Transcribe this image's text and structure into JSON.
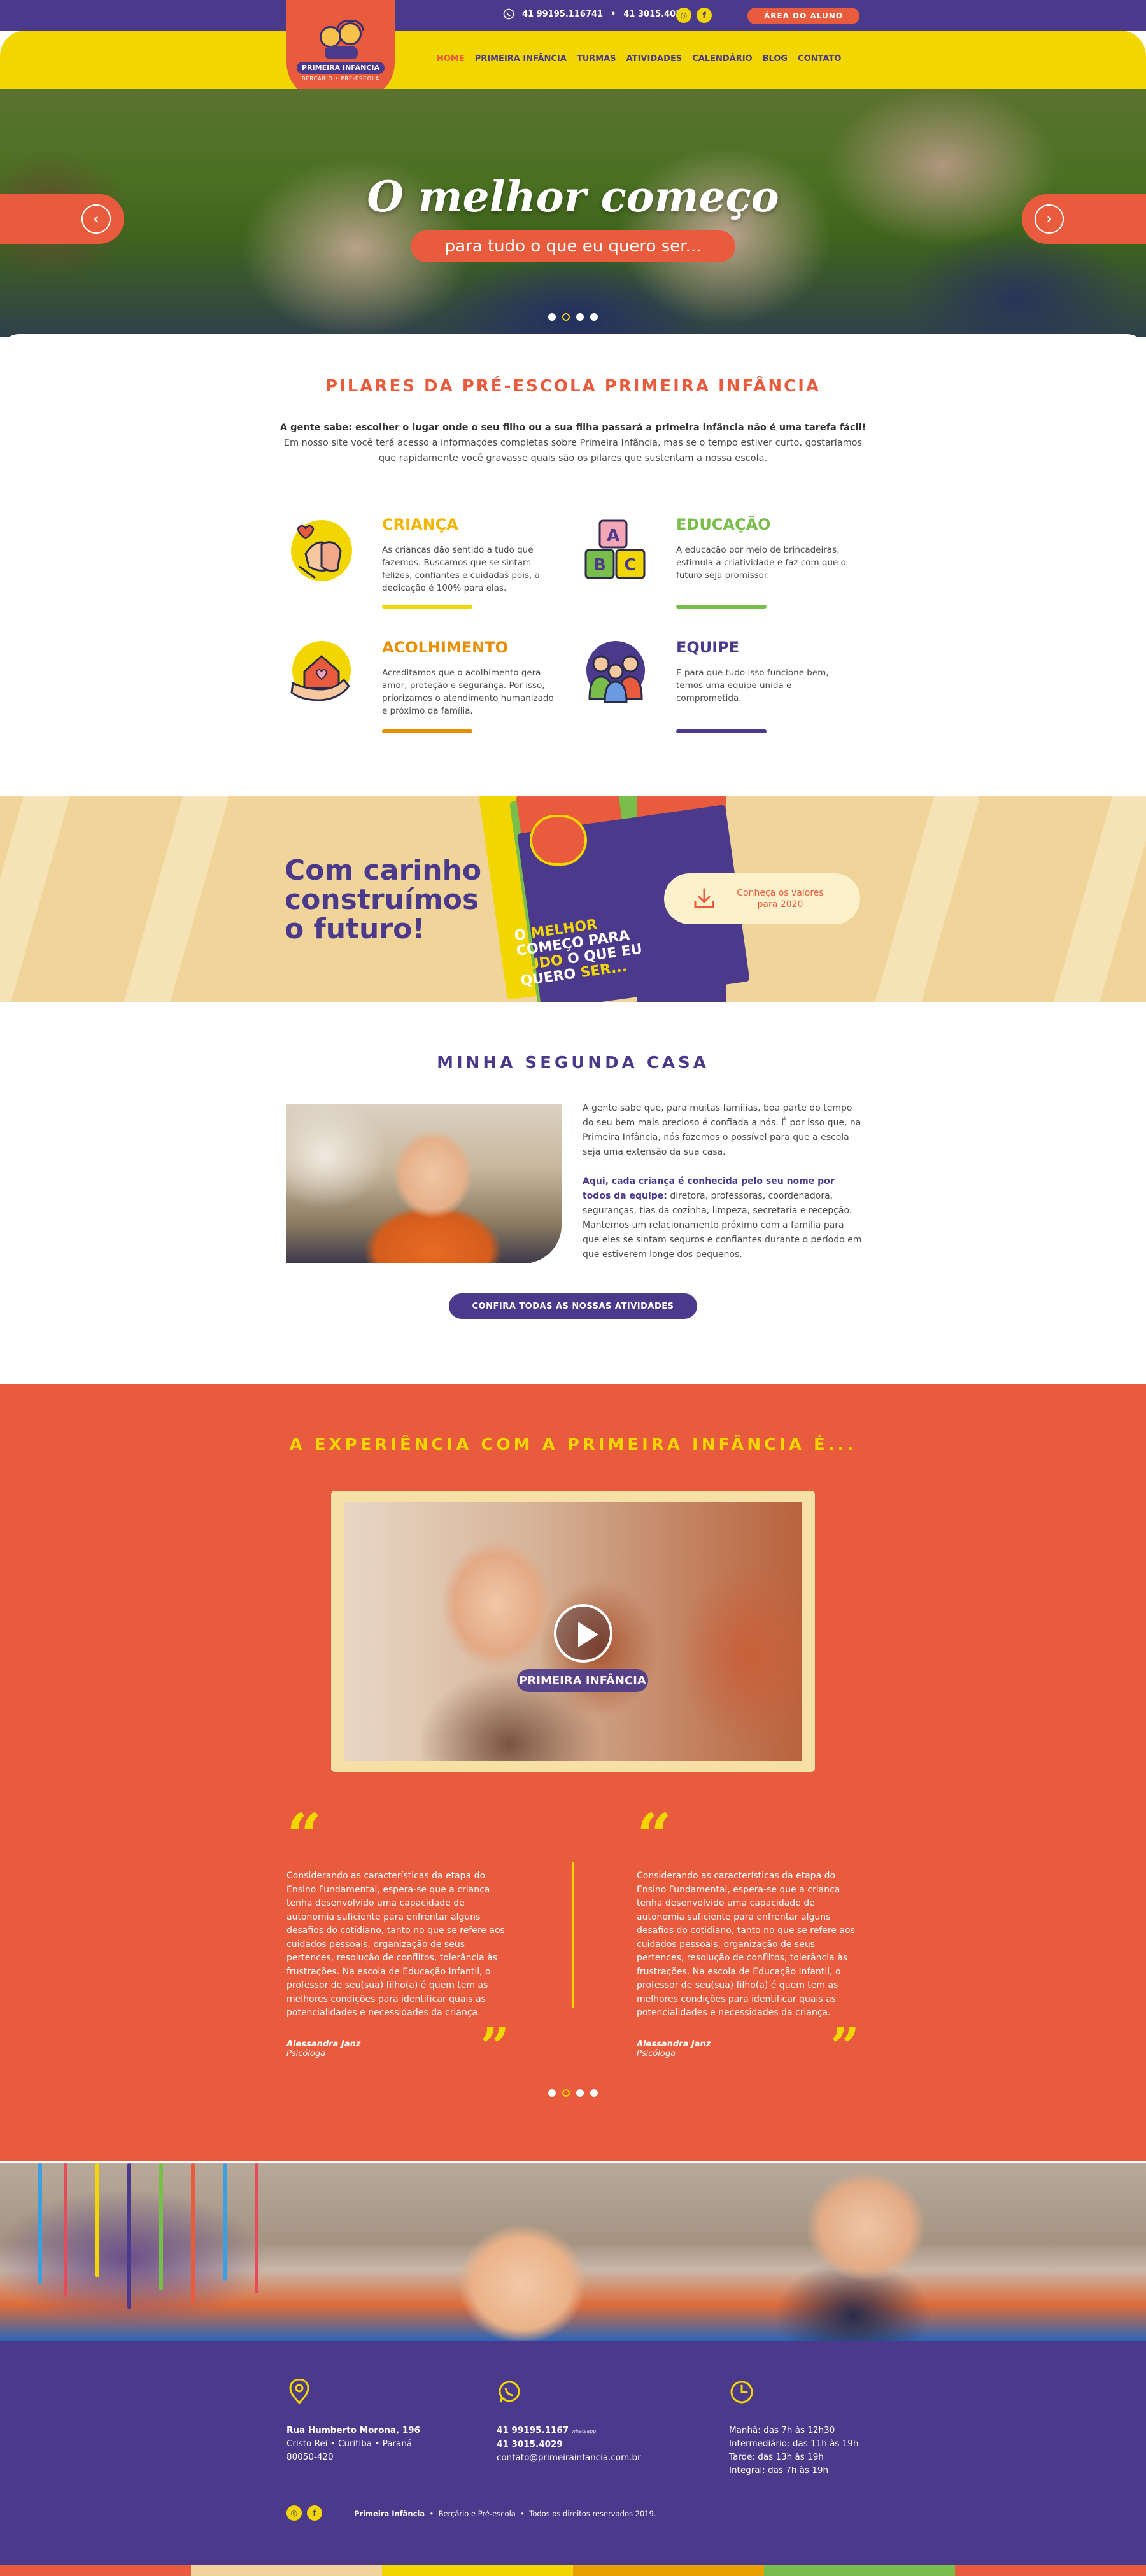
{
  "colors": {
    "purple": "#4b3a8b",
    "orange": "#e85c3d",
    "yellow": "#f2d600",
    "green": "#79bd4a",
    "sand": "#f0d49a"
  },
  "topbar": {
    "whatsapp_icon": "whatsapp-icon",
    "phone_1": "41 99195.116741",
    "separator": "•",
    "phone_2": "41 3015.4029",
    "instagram_icon": "instagram-icon",
    "facebook_icon": "facebook-icon",
    "instagram_glyph": "◎",
    "facebook_glyph": "f",
    "student_area": "ÁREA DO ALUNO"
  },
  "logo": {
    "name": "PRIMEIRA INFÂNCIA",
    "sub": "BERÇÁRIO • PRÉ-ESCOLA"
  },
  "nav": {
    "items": [
      {
        "label": "HOME",
        "active": true
      },
      {
        "label": "PRIMEIRA INFÂNCIA"
      },
      {
        "label": "TURMAS"
      },
      {
        "label": "ATIVIDADES"
      },
      {
        "label": "CALENDÁRIO"
      },
      {
        "label": "BLOG"
      },
      {
        "label": "CONTATO"
      }
    ]
  },
  "hero": {
    "title": "O melhor começo",
    "subtitle": "para tudo o que eu quero ser...",
    "prev_glyph": "‹",
    "next_glyph": "›",
    "slides": 4,
    "active_slide": 2
  },
  "pillars": {
    "title": "PILARES DA PRÉ-ESCOLA PRIMEIRA INFÂNCIA",
    "intro_bold": "A gente sabe: escolher o lugar onde o seu filho ou a sua filha passará a primeira infância não é uma tarefa fácil!",
    "intro": "Em nosso site você terá acesso a informações completas sobre Primeira Infância, mas se o tempo estiver curto, gostaríamos que rapidamente você gravasse quais são os pilares que sustentam a nossa escola.",
    "items": [
      {
        "title": "CRIANÇA",
        "color": "#f2b600",
        "icon": "hands-heart-icon",
        "text": "As crianças dão sentido a tudo que fazemos. Buscamos que se sintam felizes, confiantes e cuidadas pois, a dedicação é 100% para elas."
      },
      {
        "title": "EDUCAÇÃO",
        "color": "#79bd4a",
        "icon": "abc-blocks-icon",
        "text": "A educação por meio de brincadeiras, estimula a criatividade e faz com que o futuro seja promissor."
      },
      {
        "title": "ACOLHIMENTO",
        "color": "#e88e00",
        "icon": "house-hand-icon",
        "text": "Acreditamos que o acolhimento gera amor, proteção e segurança. Por isso, priorizamos o atendimento humanizado e próximo da família."
      },
      {
        "title": "EQUIPE",
        "color": "#4b3a8b",
        "icon": "team-icon",
        "text": "E para que tudo isso funcione bem, temos uma equipe unida e comprometida."
      }
    ]
  },
  "carinho": {
    "title": "Com carinho construímos o futuro!",
    "flyer_text_1": "O ",
    "flyer_text_2": "MELHOR",
    "flyer_text_3": " COMEÇO PARA ",
    "flyer_text_4": "TUDO",
    "flyer_text_5": " O QUE EU QUERO ",
    "flyer_text_6": "SER...",
    "download_icon": "download-icon",
    "download_label": "Conheça os valores para 2020"
  },
  "casa": {
    "title": "MINHA SEGUNDA CASA",
    "p1": "A gente sabe que, para muitas famílias, boa parte do tempo do seu bem mais precioso é confiada a nós. É por isso que, na Primeira Infância, nós fazemos o possível para que a escola seja uma extensão da sua casa.",
    "p2_bold": "Aqui, cada criança é conhecida pelo seu nome por todos da equipe:",
    "p2": " diretora, professoras, coordenadora, seguranças, tias da cozinha, limpeza, secretaria e recepção. Mantemos um relacionamento próximo com a família para que eles se sintam seguros e confiantes durante o período em que estiverem longe dos pequenos.",
    "button": "CONFIRA TODAS AS NOSSAS ATIVIDADES"
  },
  "experience": {
    "title": "A EXPERIÊNCIA COM A PRIMEIRA INFÂNCIA É...",
    "video_brand": "PRIMEIRA INFÂNCIA",
    "play_icon": "play-icon",
    "testimonials": [
      {
        "text": "Considerando as características da etapa do Ensino Fundamental, espera-se que a criança tenha desenvolvido uma capacidade de autonomia suficiente para enfrentar alguns desafios do cotidiano, tanto no que se refere aos cuidados pessoais, organização de seus pertences, resolução de conflitos, tolerância às frustrações. Na escola de Educação Infantil, o professor de seu(sua) filho(a) é quem tem as melhores condições para identificar quais as potencialidades e necessidades da criança.",
        "author": "Alessandra Janz",
        "role": "Psicóloga"
      },
      {
        "text": "Considerando as características da etapa do Ensino Fundamental, espera-se que a criança tenha desenvolvido uma capacidade de autonomia suficiente para enfrentar alguns desafios do cotidiano, tanto no que se refere aos cuidados pessoais, organização de seus pertences, resolução de conflitos, tolerância às frustrações. Na escola de Educação Infantil, o professor de seu(sua) filho(a) é quem tem as melhores condições para identificar quais as potencialidades e necessidades da criança.",
        "author": "Alessandra Janz",
        "role": "Psicóloga"
      }
    ],
    "quote_open": "“",
    "quote_close": "”",
    "slides": 4,
    "active_slide": 2
  },
  "footer": {
    "address_icon": "location-pin-icon",
    "address_street": "Rua Humberto Morona, 196",
    "address_city": "Cristo Rei  •  Curitiba  •  Paraná",
    "address_zip": "80050-420",
    "phone_icon": "whatsapp-icon",
    "phone_1": "41 99195.1167",
    "phone_1_note": "whatsapp",
    "phone_2": "41 3015.4029",
    "email": "contato@primeirainfancia.com.br",
    "hours_icon": "clock-icon",
    "hours": [
      "Manhã: das 7h às 12h30",
      "Intermediário: das 11h às 19h",
      "Tarde: das 13h às 19h",
      "Integral: das 7h às 19h"
    ],
    "brand": "Primeira Infância",
    "sep": "•",
    "tagline": "Berçário e Pré-escola",
    "copyright": "Todos os direitos reservados 2019."
  }
}
